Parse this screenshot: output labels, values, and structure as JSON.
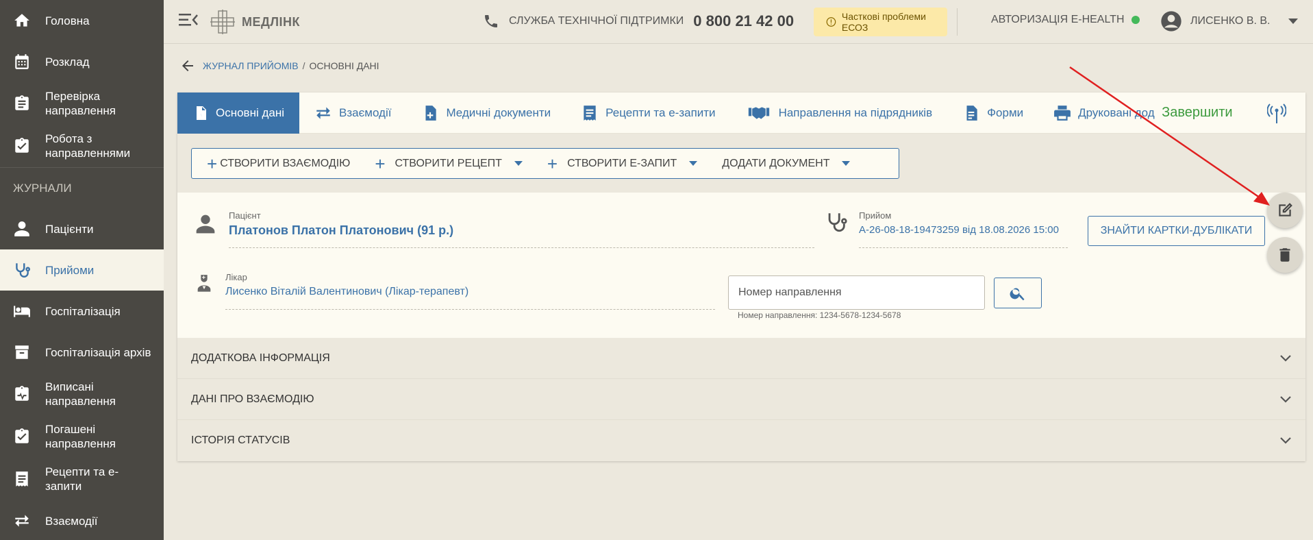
{
  "colors": {
    "accent": "#3b72a8",
    "sidebar_bg": "#4a4843",
    "finish_green": "#3c9a3d",
    "warning_bg": "#fce9a8",
    "online": "#44b95a",
    "annotation_red": "#e02020"
  },
  "sidebar": {
    "items": [
      {
        "label": "Головна",
        "icon": "home-icon"
      },
      {
        "label": "Розклад",
        "icon": "calendar-icon"
      },
      {
        "label": "Перевірка направлення",
        "icon": "clipboard-check-icon"
      },
      {
        "label": "Робота з направленнями",
        "icon": "clipboard-icon"
      }
    ],
    "section_label": "ЖУРНАЛИ",
    "journal_items": [
      {
        "label": "Пацієнти",
        "icon": "person-icon"
      },
      {
        "label": "Прийоми",
        "icon": "stethoscope-icon",
        "active": true
      },
      {
        "label": "Госпіталізація",
        "icon": "bed-icon"
      },
      {
        "label": "Госпіталізація архів",
        "icon": "archive-icon"
      },
      {
        "label": "Виписані направлення",
        "icon": "clipboard-pulse-icon"
      },
      {
        "label": "Погашені направлення",
        "icon": "clipboard-done-icon"
      },
      {
        "label": "Рецепти та е-запити",
        "icon": "receipt-icon"
      },
      {
        "label": "Взаємодії",
        "icon": "swap-icon"
      }
    ]
  },
  "header": {
    "logo_text": "МЕДЛІНК",
    "support_label": "СЛУЖБА ТЕХНІЧНОЇ ПІДТРИМКИ",
    "support_phone": "0 800 21 42 00",
    "status_text": "Часткові проблеми ЕСОЗ",
    "auth_label": "АВТОРИЗАЦІЯ E-HEALTH",
    "user_name": "ЛИСЕНКО В. В."
  },
  "breadcrumb": {
    "parent": "ЖУРНАЛ ПРИЙОМІВ",
    "separator": "/",
    "current": "ОСНОВНІ ДАНІ"
  },
  "tabs": [
    {
      "label": "Основні дані",
      "icon": "chart-doc-icon",
      "active": true
    },
    {
      "label": "Взаємодії",
      "icon": "swap-icon"
    },
    {
      "label": "Медичні документи",
      "icon": "med-doc-icon"
    },
    {
      "label": "Рецепти та е-запити",
      "icon": "receipt-icon"
    },
    {
      "label": "Направлення на підрядників",
      "icon": "handshake-icon"
    },
    {
      "label": "Форми",
      "icon": "form-icon"
    },
    {
      "label": "Друковані дод",
      "icon": "printer-icon"
    }
  ],
  "finish_label": "Завершити",
  "actions": {
    "create_interaction": "СТВОРИТИ ВЗАЄМОДІЮ",
    "create_recipe": "СТВОРИТИ РЕЦЕПТ",
    "create_erequest": "СТВОРИТИ Е-ЗАПИТ",
    "add_document": "ДОДАТИ ДОКУМЕНТ"
  },
  "patient": {
    "label": "Пацієнт",
    "value": "Платонов Платон Платонович (91 р.)"
  },
  "visit": {
    "label": "Прийом",
    "value": "A-26-08-18-19473259 від 18.08.2026 15:00"
  },
  "duplicates_button": "ЗНАЙТИ КАРТКИ-ДУБЛІКАТИ",
  "doctor": {
    "label": "Лікар",
    "value": "Лисенко Віталій Валентинович (Лікар-терапевт)"
  },
  "referral": {
    "placeholder": "Номер направлення",
    "hint": "Номер направлення: 1234-5678-1234-5678"
  },
  "accordions": [
    {
      "label": "ДОДАТКОВА ІНФОРМАЦІЯ"
    },
    {
      "label": "ДАНІ ПРО ВЗАЄМОДІЮ"
    },
    {
      "label": "ІСТОРІЯ СТАТУСІВ"
    }
  ]
}
